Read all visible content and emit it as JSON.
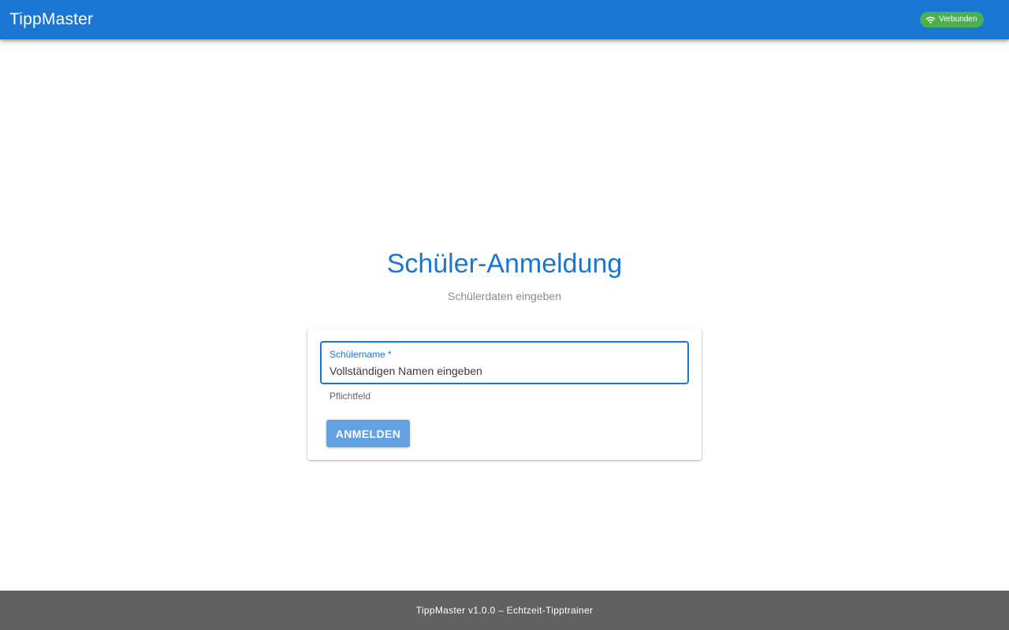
{
  "header": {
    "title": "TippMaster",
    "status": {
      "label": "Verbunden",
      "icon": "wifi-icon",
      "color": "#4caf50"
    }
  },
  "login": {
    "title": "Schüler-Anmeldung",
    "subtitle": "Schülerdaten eingeben",
    "name_field": {
      "label": "Schülername *",
      "placeholder": "Vollständigen Namen eingeben",
      "value": "",
      "helper": "Pflichtfeld"
    },
    "submit_label": "ANMELDEN"
  },
  "footer": {
    "text": "TippMaster v1.0.0 – Echtzeit-Tipptrainer"
  },
  "colors": {
    "primary": "#1976d2",
    "success": "#4caf50",
    "footer": "#616161",
    "button": "#64a1e1"
  }
}
